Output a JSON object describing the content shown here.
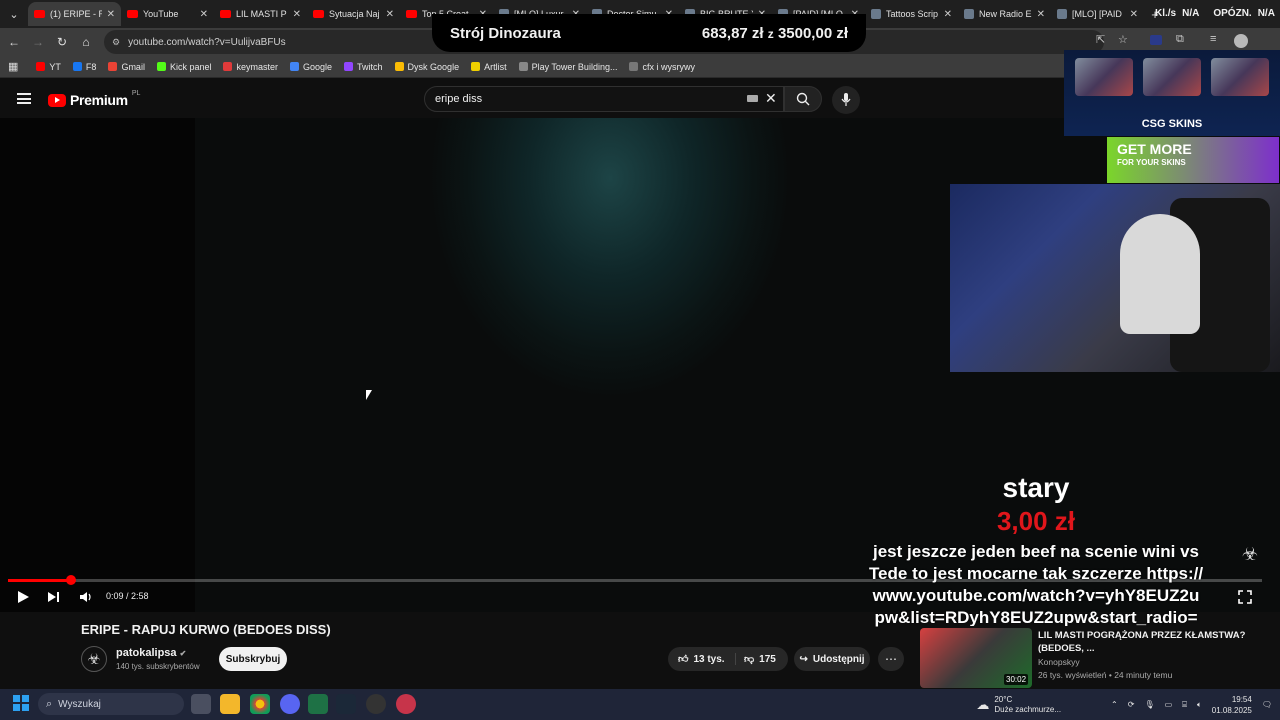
{
  "browser": {
    "tabs": [
      {
        "title": "(1) ERIPE - R",
        "icon": "youtube-icon",
        "active": true
      },
      {
        "title": "YouTube",
        "icon": "youtube-icon"
      },
      {
        "title": "LIL MASTI P",
        "icon": "youtube-icon"
      },
      {
        "title": "Sytuacja Naj",
        "icon": "youtube-icon"
      },
      {
        "title": "Top 5 Creat",
        "icon": "youtube-icon"
      },
      {
        "title": "[MLO] Luxur",
        "icon": "page-icon"
      },
      {
        "title": "Doctor Simu",
        "icon": "page-icon"
      },
      {
        "title": "BIG BRUTE X",
        "icon": "page-icon"
      },
      {
        "title": "[PAID] [MLO",
        "icon": "page-icon"
      },
      {
        "title": "Tattoos Scrip",
        "icon": "page-icon"
      },
      {
        "title": "New Radio E",
        "icon": "page-icon"
      },
      {
        "title": "[MLO] [PAID",
        "icon": "page-icon"
      }
    ],
    "new_tab": "+",
    "url": "youtube.com/watch?v=UulijvaBFUs",
    "bookmarks": [
      {
        "label": "YT",
        "color": "#ff0000"
      },
      {
        "label": "F8",
        "color": "#1877f2"
      },
      {
        "label": "Gmail",
        "color": "#ea4335"
      },
      {
        "label": "Kick panel",
        "color": "#53fc18"
      },
      {
        "label": "keymaster",
        "color": "#e03a3a"
      },
      {
        "label": "Google",
        "color": "#4285f4"
      },
      {
        "label": "Twitch",
        "color": "#9146ff"
      },
      {
        "label": "Dysk Google",
        "color": "#fbbc04"
      },
      {
        "label": "Artlist",
        "color": "#f0d000"
      },
      {
        "label": "Play Tower Building...",
        "color": "#888888"
      },
      {
        "label": "cfx i wysrywy",
        "color": "#777777"
      }
    ]
  },
  "stream_overlay": {
    "goal_title": "Strój Dinozaura",
    "goal_progress": "683,87 zł",
    "goal_separator": "z",
    "goal_target": "3500,00 zł",
    "kl_label": "Kl./s",
    "kl_value": "N/A",
    "opozn_label": "OPÓZN.",
    "opozn_value": "N/A",
    "csgo_brand": "CSG SKINS",
    "ad_line1": "GET MORE",
    "ad_line2": "FOR YOUR SKINS",
    "donation_from": "stary",
    "donation_amount": "3,00 zł",
    "donation_message": "jest jeszcze jeden beef na scenie wini vs Tede to jest mocarne tak szczerze https:// www.youtube.com/watch?v=yhY8EUZ2u pw&list=RDyhY8EUZ2upw&start_radio="
  },
  "youtube": {
    "logo_text": "Premium",
    "region": "PL",
    "search_value": "eripe diss",
    "player": {
      "current_time": "0:09",
      "duration": "2:58",
      "time_display": "0:09 / 2:58",
      "progress_fraction": 0.0506
    },
    "video_title": "ERIPE - RAPUJ KURWO (BEDOES DISS)",
    "channel_name": "patokalipsa",
    "subscribers": "140 tys. subskrybentów",
    "subscribe_label": "Subskrybuj",
    "likes": "13 tys.",
    "dislikes": "175",
    "share_label": "Udostępnij",
    "recommended": {
      "title": "LIL MASTI POGRĄŻONA PRZEZ KŁAMSTWA? (BEDOES, ...",
      "channel": "Konopskyy",
      "meta": "26 tys. wyświetleń • 24 minuty temu",
      "duration": "30:02"
    }
  },
  "taskbar": {
    "search_placeholder": "Wyszukaj",
    "weather_temp": "20°C",
    "weather_desc": "Duże zachmurze...",
    "time": "19:54",
    "date": "01.08.2025"
  },
  "colors": {
    "accent": "#ff0000",
    "donation_amount": "#e0161b"
  }
}
